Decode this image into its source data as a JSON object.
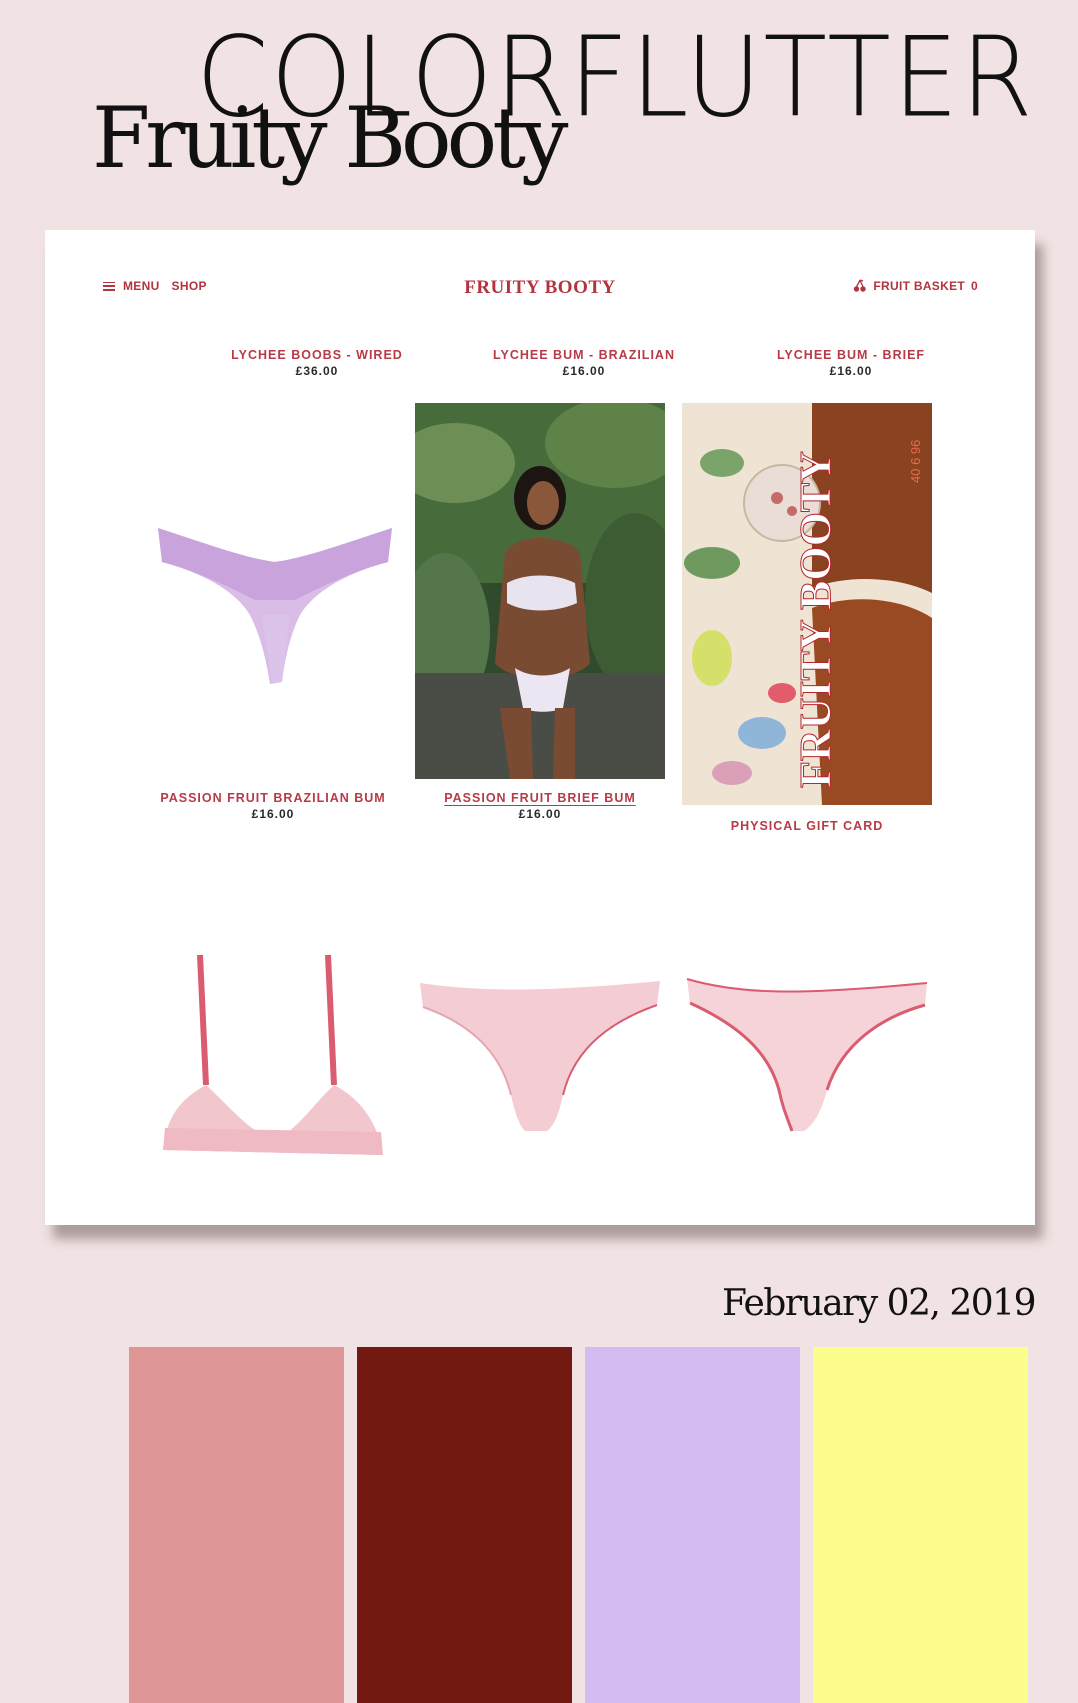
{
  "brand": "COLORFLUTTER",
  "subtitle": "Fruity Booty",
  "date": "February 02, 2019",
  "site": {
    "nav": {
      "menu": "MENU",
      "shop": "SHOP",
      "logo": "FRUITY BOOTY",
      "basket": "FRUIT BASKET",
      "basket_count": "0"
    },
    "products": [
      {
        "name": "LYCHEE BOOBS - WIRED",
        "price": "£36.00"
      },
      {
        "name": "LYCHEE BUM - BRAZILIAN",
        "price": "£16.00"
      },
      {
        "name": "LYCHEE BUM - BRIEF",
        "price": "£16.00"
      },
      {
        "name": "PASSION FRUIT BRAZILIAN BUM",
        "price": "£16.00"
      },
      {
        "name": "PASSION FRUIT BRIEF BUM",
        "price": "£16.00"
      },
      {
        "name": "PHYSICAL GIFT CARD",
        "price": ""
      }
    ],
    "gift_card_text": "FRUITY BOOTY",
    "gift_card_numbers": "40 6 96"
  },
  "palette": [
    "#de9795",
    "#741812",
    "#d4bbf2",
    "#fdfd8b"
  ],
  "icons": {
    "menu": "hamburger-icon",
    "basket": "cherry-icon"
  }
}
